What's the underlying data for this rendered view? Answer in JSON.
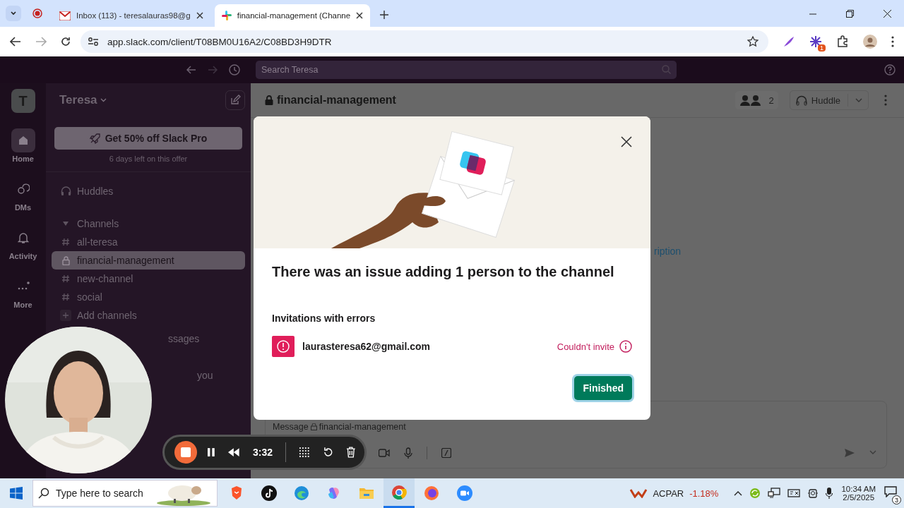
{
  "browser": {
    "tabs": [
      {
        "title": "Inbox (113) - teresalauras98@g",
        "kind": "mail",
        "selected": false
      },
      {
        "title": "financial-management (Channe",
        "kind": "slack",
        "selected": true
      }
    ],
    "url": "app.slack.com/client/T08BM0U16A2/C08BD3H9DTR",
    "extension_badge": "1"
  },
  "slack": {
    "search": {
      "placeholder": "Search Teresa"
    },
    "workspace_initial": "T",
    "workspace_name": "Teresa",
    "rail": [
      {
        "label": "Home",
        "kind": "home",
        "selected": true
      },
      {
        "label": "DMs",
        "kind": "dms",
        "selected": false
      },
      {
        "label": "Activity",
        "kind": "activity",
        "selected": false
      },
      {
        "label": "More",
        "kind": "more",
        "selected": false
      }
    ],
    "promo": {
      "button": "Get 50% off Slack Pro",
      "note": "6 days left on this offer"
    },
    "sidebar": [
      {
        "kind": "huddles",
        "label": "Huddles",
        "selected": false
      },
      {
        "kind": "section",
        "label": "Channels",
        "selected": false,
        "expanded": true
      },
      {
        "kind": "public",
        "label": "all-teresa",
        "selected": false
      },
      {
        "kind": "private",
        "label": "financial-management",
        "selected": true
      },
      {
        "kind": "public",
        "label": "new-channel",
        "selected": false
      },
      {
        "kind": "public",
        "label": "social",
        "selected": false
      },
      {
        "kind": "add",
        "label": "Add channels",
        "selected": false
      }
    ],
    "sidebar_fragments": [
      "ssages",
      "you"
    ],
    "channel": {
      "name": "financial-management",
      "member_count": "2",
      "huddle": "Huddle",
      "link_fragment": "ription",
      "composer_prefix": "Message",
      "composer_channel": "financial-management"
    }
  },
  "modal": {
    "title": "There was an issue adding 1 person to the channel",
    "section": "Invitations with errors",
    "errors": [
      {
        "email": "laurasteresa62@gmail.com",
        "status": "Couldn't invite"
      }
    ],
    "button": "Finished"
  },
  "recorder": {
    "time": "3:32"
  },
  "taskbar": {
    "search_placeholder": "Type here to search",
    "ticker": {
      "symbol": "ACPAR",
      "change": "-1.18%"
    },
    "time": "10:34 AM",
    "date": "2/5/2025",
    "notifications": "3"
  }
}
